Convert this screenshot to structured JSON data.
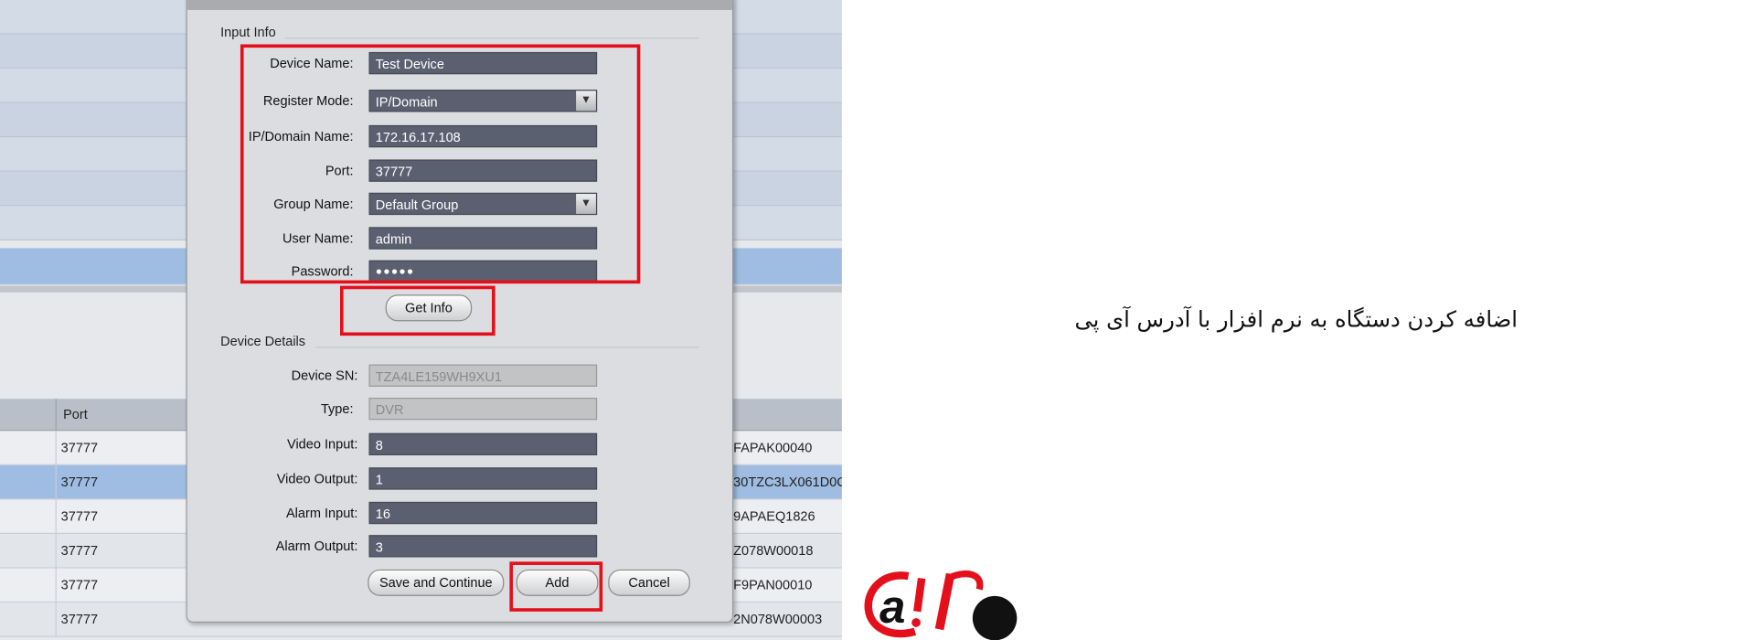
{
  "background_app": {
    "table_header": {
      "port": "Port"
    },
    "rows": [
      {
        "port": "37777",
        "serial": "FAPAK00040",
        "selected": false
      },
      {
        "port": "37777",
        "serial": "30TZC3LX061D0C",
        "selected": true
      },
      {
        "port": "37777",
        "serial": "9APAEQ1826",
        "selected": false
      },
      {
        "port": "37777",
        "serial": "Z078W00018",
        "selected": false
      },
      {
        "port": "37777",
        "serial": "F9PAN00010",
        "selected": false
      },
      {
        "port": "37777",
        "serial": "2N078W00003",
        "selected": false
      }
    ]
  },
  "dialog": {
    "input_info": {
      "title": "Input Info",
      "device_name": {
        "label": "Device Name:",
        "value": "Test Device"
      },
      "register_mode": {
        "label": "Register Mode:",
        "value": "IP/Domain"
      },
      "ip_domain": {
        "label": "IP/Domain Name:",
        "value": "172.16.17.108"
      },
      "port": {
        "label": "Port:",
        "value": "37777"
      },
      "group_name": {
        "label": "Group Name:",
        "value": "Default Group"
      },
      "user_name": {
        "label": "User Name:",
        "value": "admin"
      },
      "password": {
        "label": "Password:",
        "value": "●●●●●"
      },
      "get_info": "Get Info"
    },
    "device_details": {
      "title": "Device Details",
      "device_sn": {
        "label": "Device SN:",
        "value": "TZA4LE159WH9XU1"
      },
      "type": {
        "label": "Type:",
        "value": "DVR"
      },
      "video_input": {
        "label": "Video Input:",
        "value": "8"
      },
      "video_output": {
        "label": "Video Output:",
        "value": "1"
      },
      "alarm_input": {
        "label": "Alarm Input:",
        "value": "16"
      },
      "alarm_output": {
        "label": "Alarm Output:",
        "value": "3"
      }
    },
    "buttons": {
      "save_continue": "Save and Continue",
      "add": "Add",
      "cancel": "Cancel"
    }
  },
  "caption": "اضافه کردن دستگاه به نرم افزار با آدرس آی پی",
  "logo": {
    "text": "@ir",
    "colors": {
      "red": "#e3101b",
      "black": "#111111"
    }
  },
  "colors": {
    "highlight": "#e3101b",
    "field_bg": "#5a6070",
    "selected_row": "#9fbde3"
  }
}
